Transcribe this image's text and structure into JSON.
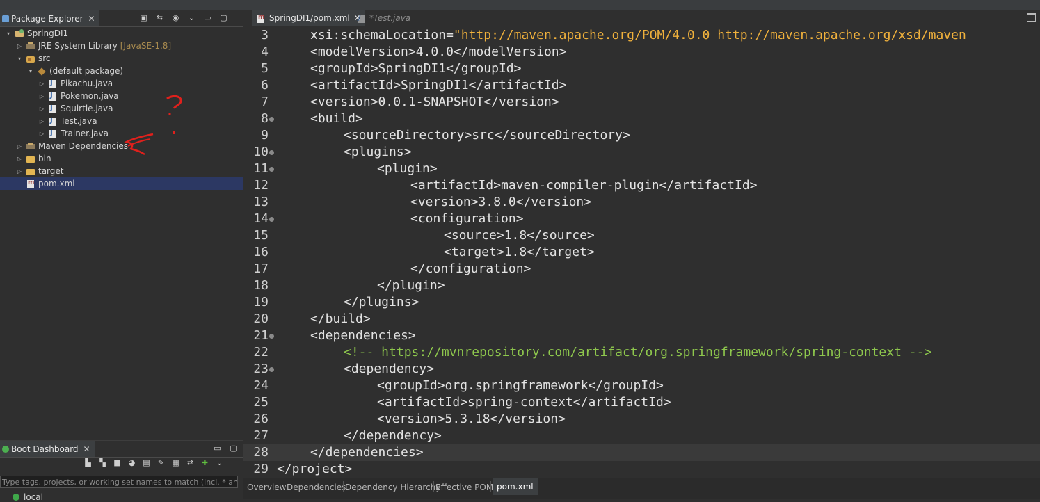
{
  "package_explorer": {
    "title": "Package Explorer",
    "close": "✕",
    "tree": [
      {
        "label": "SpringDI1",
        "icon": "project-icon",
        "indent": 0,
        "arrow": "▾",
        "selected": false
      },
      {
        "label": "JRE System Library",
        "decor": "[JavaSE-1.8]",
        "icon": "library-icon",
        "indent": 1,
        "arrow": "▷",
        "selected": false
      },
      {
        "label": "src",
        "icon": "source-folder-icon",
        "indent": 1,
        "arrow": "▾",
        "selected": false
      },
      {
        "label": "(default package)",
        "icon": "package-icon",
        "indent": 2,
        "arrow": "▾",
        "selected": false
      },
      {
        "label": "Pikachu.java",
        "icon": "java-file-icon",
        "indent": 3,
        "arrow": "▷",
        "selected": false
      },
      {
        "label": "Pokemon.java",
        "icon": "java-file-icon",
        "indent": 3,
        "arrow": "▷",
        "selected": false
      },
      {
        "label": "Squirtle.java",
        "icon": "java-file-icon",
        "indent": 3,
        "arrow": "▷",
        "selected": false
      },
      {
        "label": "Test.java",
        "icon": "java-file-icon",
        "indent": 3,
        "arrow": "▷",
        "selected": false
      },
      {
        "label": "Trainer.java",
        "icon": "java-file-icon",
        "indent": 3,
        "arrow": "▷",
        "selected": false
      },
      {
        "label": "Maven Dependencies",
        "icon": "library-icon",
        "indent": 1,
        "arrow": "▷",
        "selected": false
      },
      {
        "label": "bin",
        "icon": "folder-icon",
        "indent": 1,
        "arrow": "▷",
        "selected": false
      },
      {
        "label": "target",
        "icon": "folder-icon",
        "indent": 1,
        "arrow": "▷",
        "selected": false
      },
      {
        "label": "pom.xml",
        "icon": "xml-file-icon",
        "indent": 1,
        "arrow": "",
        "selected": true
      }
    ]
  },
  "boot_dashboard": {
    "title": "Boot Dashboard",
    "close": "✕",
    "filter_placeholder": "Type tags, projects, or working set names to match (incl. * and",
    "local_label": "local"
  },
  "editor": {
    "tabs": [
      {
        "label": "SpringDI1/pom.xml",
        "active": true,
        "close": "✕"
      },
      {
        "label": "*Test.java",
        "active": false
      }
    ],
    "lines": [
      {
        "n": "3",
        "fold": false,
        "indent": 1,
        "parts": [
          [
            "t",
            "xsi:schemaLocation="
          ],
          [
            "s",
            "\"http://maven.apache.org/POM/4.0.0 http://maven.apache.org/xsd/maven"
          ]
        ]
      },
      {
        "n": "4",
        "fold": false,
        "indent": 1,
        "parts": [
          [
            "t",
            "<modelVersion>"
          ],
          [
            "t",
            "4.0.0"
          ],
          [
            "t",
            "</modelVersion>"
          ]
        ]
      },
      {
        "n": "5",
        "fold": false,
        "indent": 1,
        "parts": [
          [
            "t",
            "<groupId>"
          ],
          [
            "t",
            "SpringDI1"
          ],
          [
            "t",
            "</groupId>"
          ]
        ]
      },
      {
        "n": "6",
        "fold": false,
        "indent": 1,
        "parts": [
          [
            "t",
            "<artifactId>"
          ],
          [
            "t",
            "SpringDI1"
          ],
          [
            "t",
            "</artifactId>"
          ]
        ]
      },
      {
        "n": "7",
        "fold": false,
        "indent": 1,
        "parts": [
          [
            "t",
            "<version>"
          ],
          [
            "t",
            "0.0.1-SNAPSHOT"
          ],
          [
            "t",
            "</version>"
          ]
        ]
      },
      {
        "n": "8",
        "fold": true,
        "indent": 1,
        "parts": [
          [
            "t",
            "<build>"
          ]
        ]
      },
      {
        "n": "9",
        "fold": false,
        "indent": 2,
        "parts": [
          [
            "t",
            "<sourceDirectory>"
          ],
          [
            "t",
            "src"
          ],
          [
            "t",
            "</sourceDirectory>"
          ]
        ]
      },
      {
        "n": "10",
        "fold": true,
        "indent": 2,
        "parts": [
          [
            "t",
            "<plugins>"
          ]
        ]
      },
      {
        "n": "11",
        "fold": true,
        "indent": 3,
        "parts": [
          [
            "t",
            "<plugin>"
          ]
        ]
      },
      {
        "n": "12",
        "fold": false,
        "indent": 4,
        "parts": [
          [
            "t",
            "<artifactId>"
          ],
          [
            "t",
            "maven-compiler-plugin"
          ],
          [
            "t",
            "</artifactId>"
          ]
        ]
      },
      {
        "n": "13",
        "fold": false,
        "indent": 4,
        "parts": [
          [
            "t",
            "<version>"
          ],
          [
            "t",
            "3.8.0"
          ],
          [
            "t",
            "</version>"
          ]
        ]
      },
      {
        "n": "14",
        "fold": true,
        "indent": 4,
        "parts": [
          [
            "t",
            "<configuration>"
          ]
        ]
      },
      {
        "n": "15",
        "fold": false,
        "indent": 5,
        "parts": [
          [
            "t",
            "<source>"
          ],
          [
            "t",
            "1.8"
          ],
          [
            "t",
            "</source>"
          ]
        ]
      },
      {
        "n": "16",
        "fold": false,
        "indent": 5,
        "parts": [
          [
            "t",
            "<target>"
          ],
          [
            "t",
            "1.8"
          ],
          [
            "t",
            "</target>"
          ]
        ]
      },
      {
        "n": "17",
        "fold": false,
        "indent": 4,
        "parts": [
          [
            "t",
            "</configuration>"
          ]
        ]
      },
      {
        "n": "18",
        "fold": false,
        "indent": 3,
        "parts": [
          [
            "t",
            "</plugin>"
          ]
        ]
      },
      {
        "n": "19",
        "fold": false,
        "indent": 2,
        "parts": [
          [
            "t",
            "</plugins>"
          ]
        ]
      },
      {
        "n": "20",
        "fold": false,
        "indent": 1,
        "parts": [
          [
            "t",
            "</build>"
          ]
        ]
      },
      {
        "n": "21",
        "fold": true,
        "indent": 1,
        "parts": [
          [
            "t",
            "<dependencies>"
          ]
        ]
      },
      {
        "n": "22",
        "fold": false,
        "indent": 2,
        "parts": [
          [
            "c",
            "<!-- https://mvnrepository.com/artifact/org.springframework/spring-context -->"
          ]
        ]
      },
      {
        "n": "23",
        "fold": true,
        "indent": 2,
        "parts": [
          [
            "t",
            "<dependency>"
          ]
        ]
      },
      {
        "n": "24",
        "fold": false,
        "indent": 3,
        "parts": [
          [
            "t",
            "<groupId>"
          ],
          [
            "t",
            "org.springframework"
          ],
          [
            "t",
            "</groupId>"
          ]
        ]
      },
      {
        "n": "25",
        "fold": false,
        "indent": 3,
        "parts": [
          [
            "t",
            "<artifactId>"
          ],
          [
            "t",
            "spring-context"
          ],
          [
            "t",
            "</artifactId>"
          ]
        ]
      },
      {
        "n": "26",
        "fold": false,
        "indent": 3,
        "parts": [
          [
            "t",
            "<version>"
          ],
          [
            "t",
            "5.3.18"
          ],
          [
            "t",
            "</version>"
          ]
        ]
      },
      {
        "n": "27",
        "fold": false,
        "indent": 2,
        "parts": [
          [
            "t",
            "</dependency>"
          ]
        ]
      },
      {
        "n": "28",
        "fold": false,
        "indent": 1,
        "current": true,
        "parts": [
          [
            "t",
            "</dependencies>"
          ]
        ]
      },
      {
        "n": "29",
        "fold": false,
        "indent": 0,
        "parts": [
          [
            "t",
            "</project>"
          ]
        ]
      }
    ],
    "bottom_tabs": [
      "Overview",
      "Dependencies",
      "Dependency Hierarchy",
      "Effective POM",
      "pom.xml"
    ],
    "active_bottom_tab": "pom.xml"
  },
  "colors": {
    "background": "#2f2f2f",
    "selection": "#2c3863",
    "string": "#f0b13c",
    "comment": "#8ec74d",
    "annotation": "#e0201c"
  }
}
